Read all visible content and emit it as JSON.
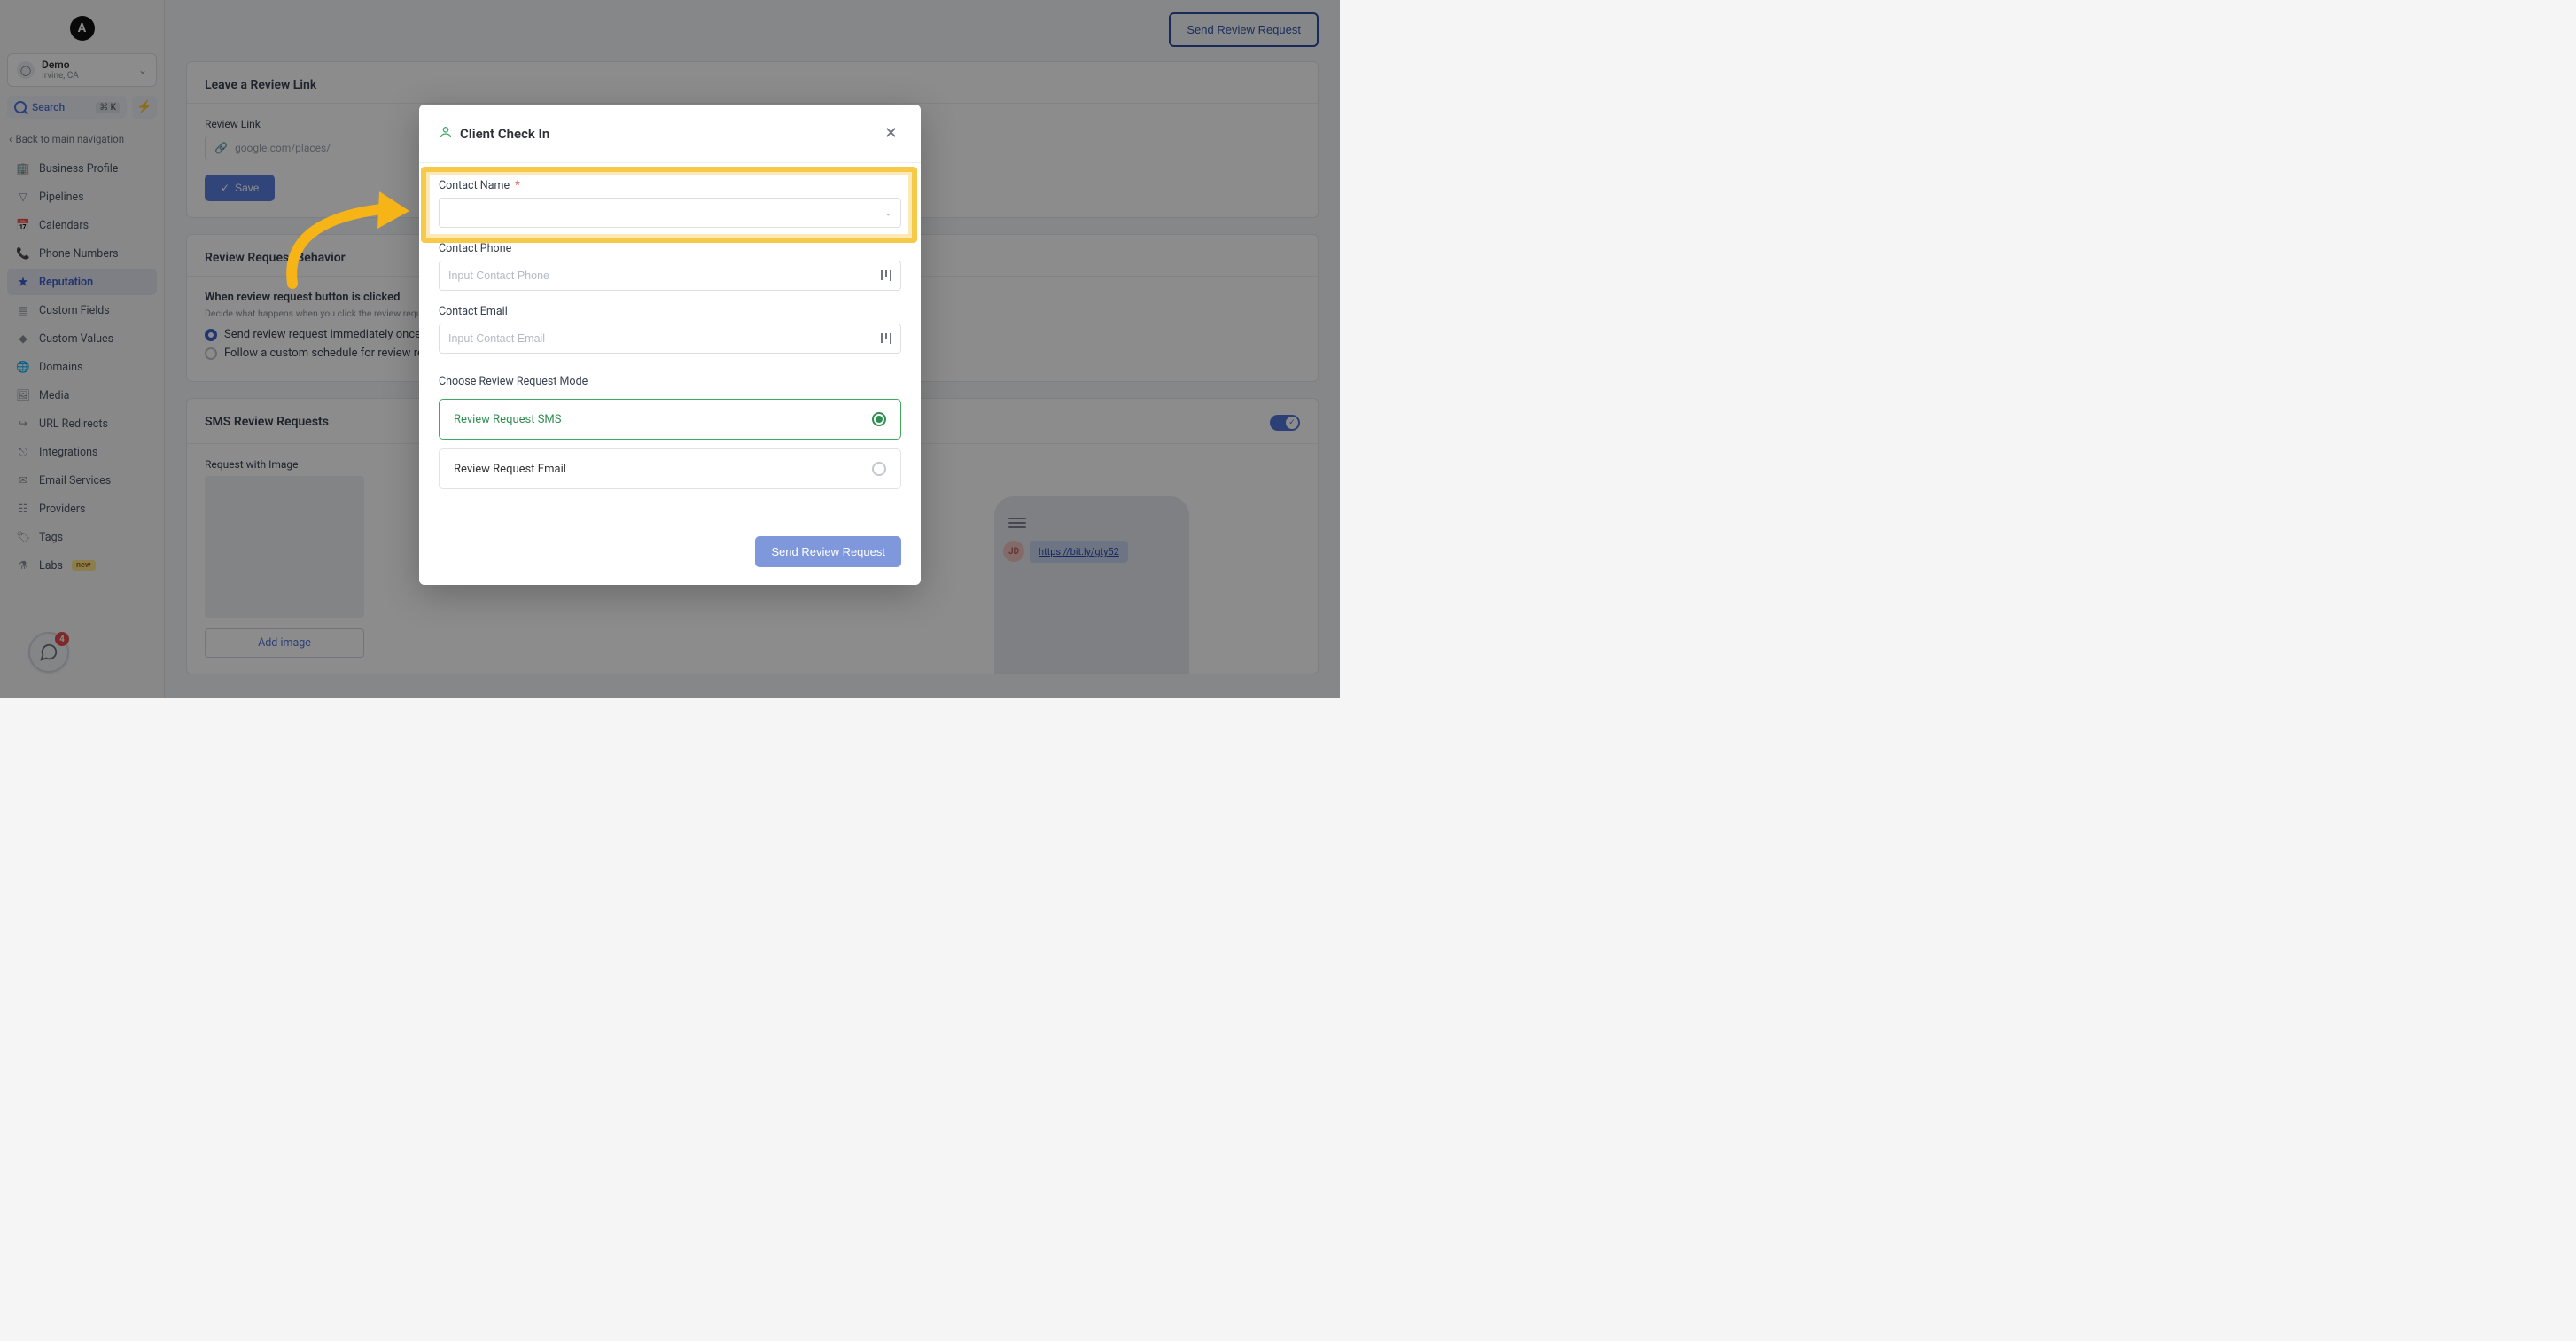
{
  "org": {
    "name": "Demo",
    "location": "Irvine, CA"
  },
  "search": {
    "label": "Search",
    "kbd": "⌘ K"
  },
  "back_nav": "Back to main navigation",
  "nav": [
    {
      "key": "business-profile",
      "label": "Business Profile"
    },
    {
      "key": "pipelines",
      "label": "Pipelines"
    },
    {
      "key": "calendars",
      "label": "Calendars"
    },
    {
      "key": "phone-numbers",
      "label": "Phone Numbers"
    },
    {
      "key": "reputation",
      "label": "Reputation",
      "active": true
    },
    {
      "key": "custom-fields",
      "label": "Custom Fields"
    },
    {
      "key": "custom-values",
      "label": "Custom Values"
    },
    {
      "key": "domains",
      "label": "Domains"
    },
    {
      "key": "media",
      "label": "Media"
    },
    {
      "key": "url-redirects",
      "label": "URL Redirects"
    },
    {
      "key": "integrations",
      "label": "Integrations"
    },
    {
      "key": "email-services",
      "label": "Email Services"
    },
    {
      "key": "providers",
      "label": "Providers"
    },
    {
      "key": "tags",
      "label": "Tags"
    },
    {
      "key": "labs",
      "label": "Labs",
      "badge": "new"
    }
  ],
  "chat_badge": "4",
  "header": {
    "send_button": "Send Review Request"
  },
  "review_link_card": {
    "title": "Leave a Review Link",
    "sub": "Review Link",
    "placeholder": "google.com/places/",
    "save": "Save"
  },
  "behavior_card": {
    "title": "Review Request Behavior",
    "sub1": "When review request button is clicked",
    "sub2": "Decide what happens when you click the review request button",
    "opt1": "Send review request immediately once",
    "opt2": "Follow a custom schedule for review requests"
  },
  "sms_card": {
    "title": "SMS Review Requests",
    "req_with_image": "Request with Image",
    "add_image": "Add image"
  },
  "phone_mock": {
    "avatar": "JD",
    "link": "https://bit.ly/gty52"
  },
  "modal": {
    "title": "Client Check In",
    "contact_name_label": "Contact Name",
    "contact_phone_label": "Contact Phone",
    "contact_phone_placeholder": "Input Contact Phone",
    "contact_email_label": "Contact Email",
    "contact_email_placeholder": "Input Contact Email",
    "mode_label": "Choose Review Request Mode",
    "mode_sms": "Review Request SMS",
    "mode_email": "Review Request Email",
    "submit": "Send Review Request"
  },
  "labs_badge": "new",
  "logo_letter": "A"
}
